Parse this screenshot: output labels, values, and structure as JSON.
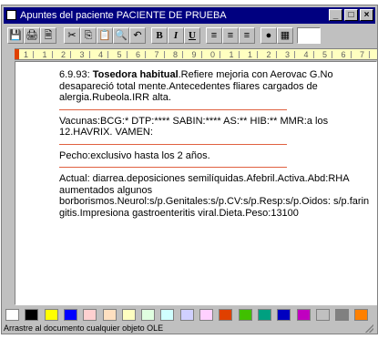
{
  "window": {
    "title": "Apuntes del paciente PACIENTE DE PRUEBA",
    "controls": [
      "minimize",
      "maximize",
      "close"
    ]
  },
  "toolbar": {
    "buttons": [
      {
        "name": "save",
        "glyph": "💾"
      },
      {
        "name": "print",
        "glyph": "🖨"
      },
      {
        "name": "preview",
        "glyph": "🗎"
      },
      {
        "name": "cut",
        "glyph": "✂"
      },
      {
        "name": "copy",
        "glyph": "⎘"
      },
      {
        "name": "paste",
        "glyph": "📋"
      },
      {
        "name": "find",
        "glyph": "🔍"
      },
      {
        "name": "undo",
        "glyph": "↶"
      },
      {
        "name": "bold",
        "glyph": "B"
      },
      {
        "name": "italic",
        "glyph": "I"
      },
      {
        "name": "underline",
        "glyph": "U"
      },
      {
        "name": "align-left",
        "glyph": "≡"
      },
      {
        "name": "align-center",
        "glyph": "≡"
      },
      {
        "name": "align-right",
        "glyph": "≡"
      },
      {
        "name": "bullet",
        "glyph": "●"
      },
      {
        "name": "object",
        "glyph": "▦"
      }
    ]
  },
  "ruler": {
    "labels": [
      "1",
      "1",
      "2",
      "3",
      "4",
      "5",
      "6",
      "7",
      "8",
      "9",
      "0",
      "1",
      "1",
      "2",
      "3",
      "4",
      "5",
      "6",
      "7"
    ]
  },
  "document": {
    "entries": [
      {
        "date": "6.9.93:",
        "heading": "Tosedora habitual",
        "text": ".Refiere mejoria con Aerovac G.No desapareció total mente.Antecedentes fliares cargados de alergia.Rubeola.IRR alta."
      },
      {
        "date": "",
        "heading": "",
        "text": "Vacunas:BCG:* DTP:**** SABIN:**** AS:** HIB:** MMR:a los 12.HAVRIX. VAMEN:"
      },
      {
        "date": "",
        "heading": "",
        "text": "Pecho:exclusivo hasta los 2 años."
      },
      {
        "date": "",
        "heading": "",
        "text": "Actual: diarrea.deposiciones semilíquidas.Afebril.Activa.Abd:RHA aumentados algunos borborismos.Neurol:s/p.Genitales:s/p.CV:s/p.Resp:s/p.Oidos: s/p.farin gitis.Impresiona gastroenteritis viral.Dieta.Peso:13100"
      }
    ]
  },
  "palette": {
    "colors": [
      "#ffffff",
      "#000000",
      "#ffff00",
      "#0000ff",
      "#ffd0d0",
      "#ffe0c0",
      "#ffffc0",
      "#e0ffe0",
      "#d0ffff",
      "#d0d0ff",
      "#ffd0ff",
      "#e04000",
      "#40c000",
      "#00a080",
      "#0000c0",
      "#c000c0",
      "#c0c0c0",
      "#808080",
      "#ff8000"
    ]
  },
  "status": {
    "message": "Arrastre al documento cualquier objeto OLE"
  }
}
